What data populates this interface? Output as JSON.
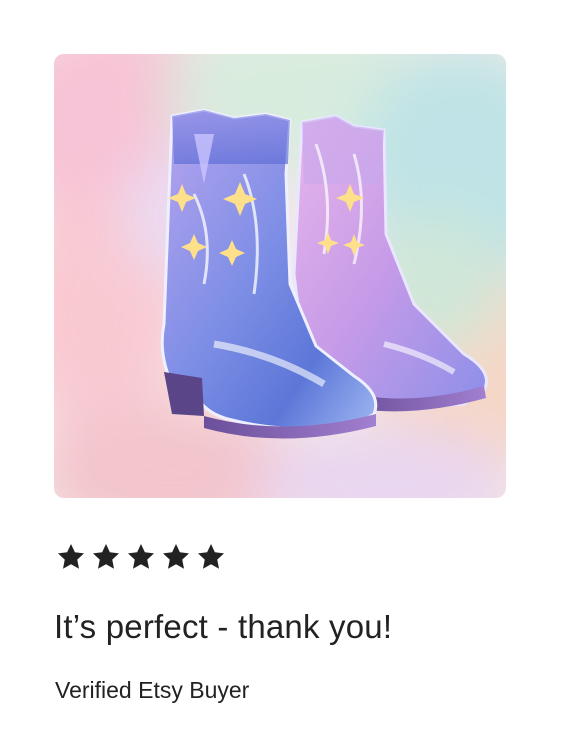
{
  "image": {
    "subject": "boots-illustration"
  },
  "rating": {
    "stars": 5,
    "max": 5,
    "star_color": "#222222"
  },
  "review": {
    "text": "It’s perfect - thank you!"
  },
  "reviewer": {
    "name": "Verified Etsy Buyer"
  },
  "colors": {
    "text": "#222222",
    "background": "#ffffff"
  }
}
